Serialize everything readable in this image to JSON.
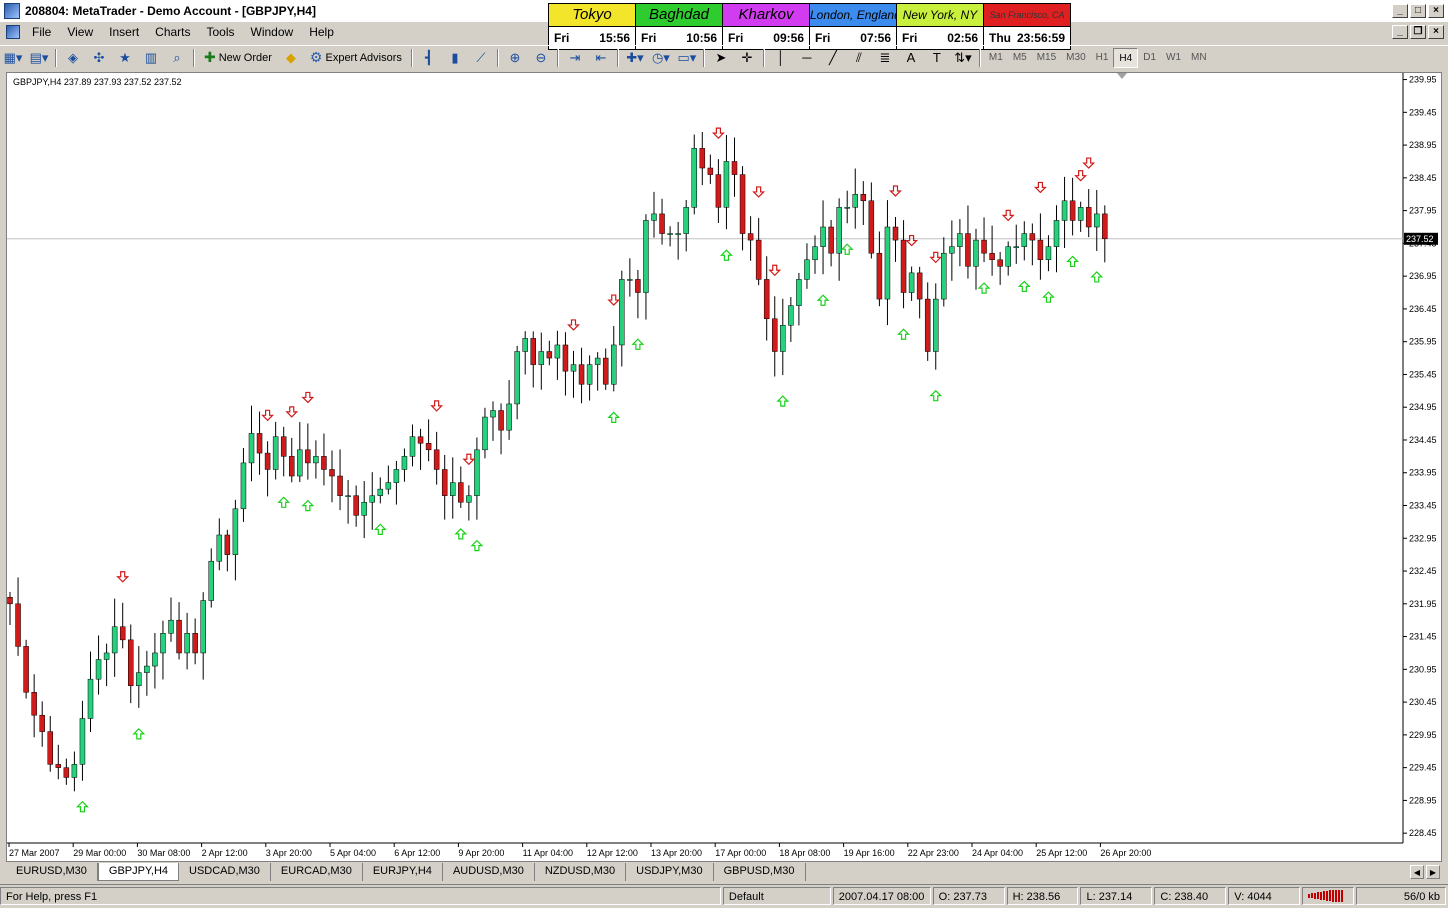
{
  "window": {
    "title": "208804: MetaTrader - Demo Account - [GBPJPY,H4]"
  },
  "menu": [
    "File",
    "View",
    "Insert",
    "Charts",
    "Tools",
    "Window",
    "Help"
  ],
  "clocks": [
    {
      "city": "Tokyo",
      "day": "Fri",
      "time": "15:56",
      "color": "#f3e52a",
      "size": "normal"
    },
    {
      "city": "Baghdad",
      "day": "Fri",
      "time": "10:56",
      "color": "#2ecc2e",
      "size": "normal"
    },
    {
      "city": "Kharkov",
      "day": "Fri",
      "time": "09:56",
      "color": "#d23cf0",
      "size": "normal"
    },
    {
      "city": "London, England",
      "day": "Fri",
      "time": "07:56",
      "color": "#3c8cf0",
      "size": "small"
    },
    {
      "city": "New York, NY",
      "day": "Fri",
      "time": "02:56",
      "color": "#c8f03c",
      "size": "small"
    },
    {
      "city": "San Francisco, CA",
      "day": "Thu",
      "time": "23:56:59",
      "color": "#e02020",
      "size": "tiny"
    }
  ],
  "toolbar": {
    "new_order_label": "New Order",
    "expert_advisors_label": "Expert Advisors",
    "timeframes": [
      "M1",
      "M5",
      "M15",
      "M30",
      "H1",
      "H4",
      "D1",
      "W1",
      "MN"
    ],
    "active_timeframe": "H4"
  },
  "chart_data": {
    "type": "candlestick",
    "symbol_info": "GBPJPY,H4  237.89 237.93 237.52 237.52",
    "current_price": 237.52,
    "current_price_label": "237.52",
    "ylim": [
      228.3,
      240.05
    ],
    "y_ticks": [
      "239.95",
      "239.45",
      "238.95",
      "238.45",
      "237.95",
      "237.45",
      "236.95",
      "236.45",
      "235.95",
      "235.45",
      "234.95",
      "234.45",
      "233.95",
      "233.45",
      "232.95",
      "232.45",
      "231.95",
      "231.45",
      "230.95",
      "230.45",
      "229.95",
      "229.45",
      "228.95",
      "228.45"
    ],
    "x_labels": [
      "27 Mar 2007",
      "29 Mar 00:00",
      "30 Mar 08:00",
      "2 Apr 12:00",
      "3 Apr 20:00",
      "5 Apr 04:00",
      "6 Apr 12:00",
      "9 Apr 20:00",
      "11 Apr 04:00",
      "12 Apr 12:00",
      "13 Apr 20:00",
      "17 Apr 00:00",
      "18 Apr 08:00",
      "19 Apr 16:00",
      "22 Apr 23:00",
      "24 Apr 04:00",
      "25 Apr 12:00",
      "26 Apr 20:00"
    ],
    "closes": [
      231.95,
      231.3,
      230.6,
      230.25,
      230.0,
      229.5,
      229.45,
      229.3,
      229.5,
      230.2,
      230.8,
      231.1,
      231.2,
      231.6,
      231.4,
      230.7,
      230.9,
      231.0,
      231.2,
      231.5,
      231.7,
      231.2,
      231.5,
      231.2,
      232.0,
      232.6,
      233.0,
      232.7,
      233.4,
      234.1,
      234.55,
      234.25,
      234.0,
      234.5,
      234.2,
      233.9,
      234.3,
      234.1,
      234.2,
      234.0,
      233.9,
      233.6,
      233.6,
      233.3,
      233.5,
      233.6,
      233.7,
      233.8,
      234.0,
      234.2,
      234.5,
      234.4,
      234.3,
      234.0,
      233.6,
      233.8,
      233.5,
      233.6,
      234.3,
      234.8,
      234.9,
      234.6,
      235.0,
      235.8,
      236.0,
      235.6,
      235.8,
      235.7,
      235.9,
      235.5,
      235.6,
      235.3,
      235.6,
      235.7,
      235.3,
      235.9,
      236.9,
      236.9,
      236.7,
      237.8,
      237.9,
      237.6,
      237.6,
      237.6,
      238.0,
      238.9,
      238.6,
      238.5,
      238.0,
      238.7,
      238.5,
      237.6,
      237.5,
      236.9,
      236.3,
      235.8,
      236.2,
      236.5,
      236.9,
      237.2,
      237.4,
      237.7,
      237.3,
      238.0,
      238.0,
      238.2,
      238.1,
      237.3,
      236.6,
      237.7,
      237.5,
      236.7,
      237.0,
      236.6,
      235.8,
      236.6,
      237.3,
      237.4,
      237.6,
      237.1,
      237.5,
      237.3,
      237.2,
      237.1,
      237.4,
      237.4,
      237.6,
      237.5,
      237.2,
      237.4,
      237.8,
      238.1,
      237.8,
      238.0,
      237.7,
      237.9,
      237.52
    ],
    "buy_signals": [
      9,
      16,
      34,
      37,
      46,
      56,
      58,
      75,
      78,
      89,
      96,
      101,
      104,
      111,
      115,
      121,
      126,
      129,
      132,
      135
    ],
    "sell_signals": [
      14,
      32,
      35,
      37,
      53,
      57,
      70,
      75,
      88,
      93,
      95,
      110,
      112,
      115,
      124,
      128,
      133,
      134,
      137
    ],
    "up_color": "#26d07c",
    "down_color": "#d11a1a",
    "buy_signal_color": "#19d119",
    "sell_signal_color": "#d11a1a",
    "grid": false
  },
  "tabs": [
    "EURUSD,M30",
    "GBPJPY,H4",
    "USDCAD,M30",
    "EURCAD,M30",
    "EURJPY,H4",
    "AUDUSD,M30",
    "NZDUSD,M30",
    "USDJPY,M30",
    "GBPUSD,M30"
  ],
  "active_tab": "GBPJPY,H4",
  "status": {
    "help": "For Help, press F1",
    "profile": "Default",
    "datetime": "2007.04.17 08:00",
    "open": "O: 237.73",
    "high": "H: 238.56",
    "low": "L: 237.14",
    "close": "C: 238.40",
    "volume": "V: 4044",
    "traffic": "56/0 kb"
  }
}
